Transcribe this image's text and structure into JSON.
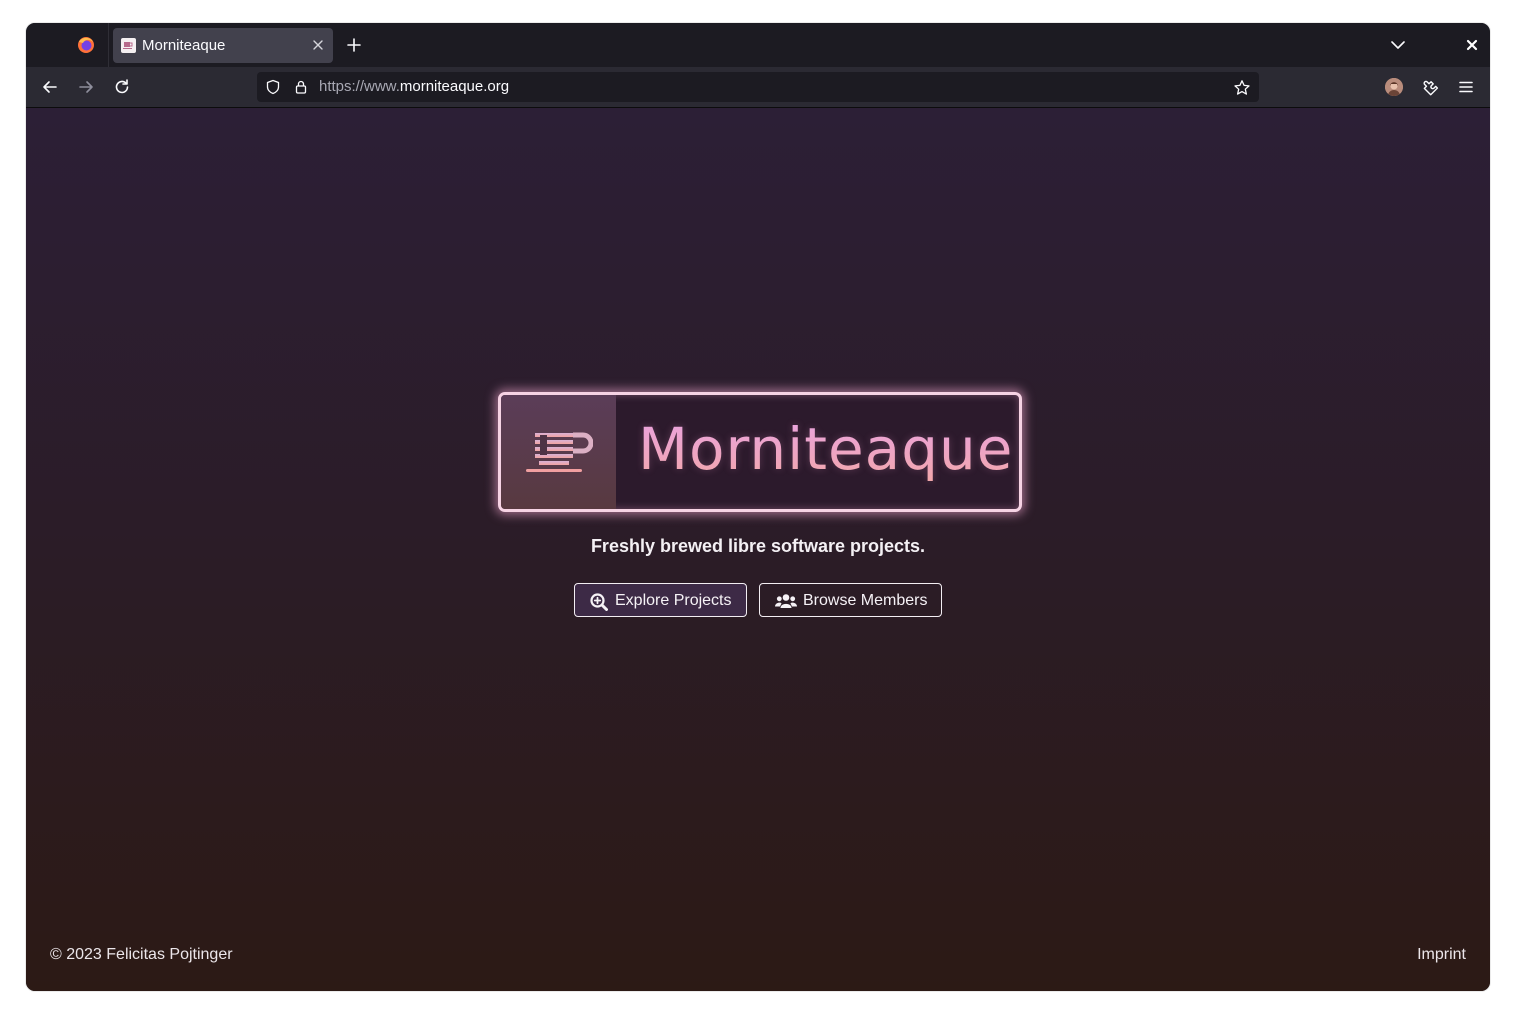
{
  "browser": {
    "tab": {
      "title": "Morniteaque"
    },
    "url": {
      "prefix": "https://www.",
      "domain": "morniteaque.org"
    },
    "icons": [
      "firefox-logo",
      "close-icon",
      "plus-icon",
      "chevron-down-icon",
      "back-icon",
      "forward-icon",
      "reload-icon",
      "shield-icon",
      "lock-icon",
      "star-icon",
      "avatar",
      "extensions-icon",
      "hamburger-menu-icon"
    ]
  },
  "hero": {
    "logo_text": "Morniteaque",
    "tagline": "Freshly brewed libre software projects.",
    "buttons": {
      "explore": "Explore Projects",
      "members": "Browse Members"
    }
  },
  "footer": {
    "copyright": "© 2023 Felicitas Pojtinger",
    "imprint": "Imprint"
  },
  "colors": {
    "page_top": "#2c1f36",
    "page_bottom": "#2c1a15",
    "logo_gradient_start": "#e9a5e6",
    "logo_gradient_end": "#f3a9a6",
    "browser_chrome": "#2b2a33"
  }
}
